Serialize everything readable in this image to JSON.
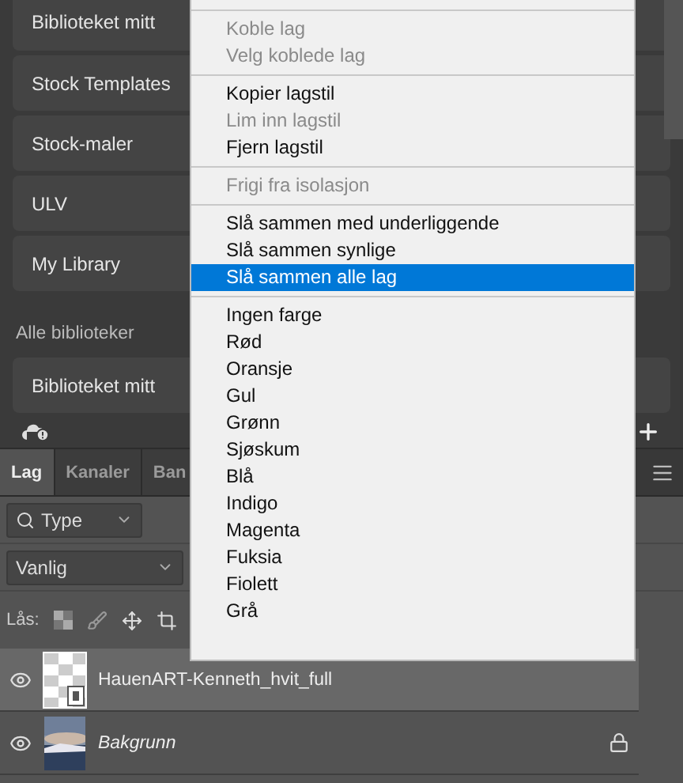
{
  "libraries": {
    "items": [
      {
        "label": "Biblioteket mitt"
      },
      {
        "label": "Stock Templates"
      },
      {
        "label": "Stock-maler"
      },
      {
        "label": "ULV"
      },
      {
        "label": "My Library"
      }
    ],
    "section_title": "Alle biblioteker",
    "section_items": [
      {
        "label": "Biblioteket mitt"
      }
    ]
  },
  "panel_tabs": [
    {
      "label": "Lag",
      "selected": true
    },
    {
      "label": "Kanaler",
      "selected": false
    },
    {
      "label": "Ban",
      "selected": false
    }
  ],
  "filter": {
    "value": "Type"
  },
  "blend_mode": {
    "value": "Vanlig"
  },
  "lock": {
    "label": "Lås:"
  },
  "layers": [
    {
      "name": "HauenART-Kenneth_hvit_full",
      "kind": "smart",
      "visible": true,
      "selected": true,
      "locked": false
    },
    {
      "name": "Bakgrunn",
      "kind": "background",
      "visible": true,
      "selected": false,
      "locked": true
    }
  ],
  "context_menu": {
    "groups": [
      [
        {
          "label": "Koble lag",
          "disabled": true,
          "selected": false
        },
        {
          "label": "Velg koblede lag",
          "disabled": true,
          "selected": false
        }
      ],
      [
        {
          "label": "Kopier lagstil",
          "disabled": false,
          "selected": false
        },
        {
          "label": "Lim inn lagstil",
          "disabled": true,
          "selected": false
        },
        {
          "label": "Fjern lagstil",
          "disabled": false,
          "selected": false
        }
      ],
      [
        {
          "label": "Frigi fra isolasjon",
          "disabled": true,
          "selected": false
        }
      ],
      [
        {
          "label": "Slå sammen med underliggende",
          "disabled": false,
          "selected": false
        },
        {
          "label": "Slå sammen synlige",
          "disabled": false,
          "selected": false
        },
        {
          "label": "Slå sammen alle lag",
          "disabled": false,
          "selected": true
        }
      ],
      [
        {
          "label": "Ingen farge",
          "disabled": false,
          "selected": false
        },
        {
          "label": "Rød",
          "disabled": false,
          "selected": false
        },
        {
          "label": "Oransje",
          "disabled": false,
          "selected": false
        },
        {
          "label": "Gul",
          "disabled": false,
          "selected": false
        },
        {
          "label": "Grønn",
          "disabled": false,
          "selected": false
        },
        {
          "label": "Sjøskum",
          "disabled": false,
          "selected": false
        },
        {
          "label": "Blå",
          "disabled": false,
          "selected": false
        },
        {
          "label": "Indigo",
          "disabled": false,
          "selected": false
        },
        {
          "label": "Magenta",
          "disabled": false,
          "selected": false
        },
        {
          "label": "Fuksia",
          "disabled": false,
          "selected": false
        },
        {
          "label": "Fiolett",
          "disabled": false,
          "selected": false
        },
        {
          "label": "Grå",
          "disabled": false,
          "selected": false
        }
      ]
    ]
  }
}
